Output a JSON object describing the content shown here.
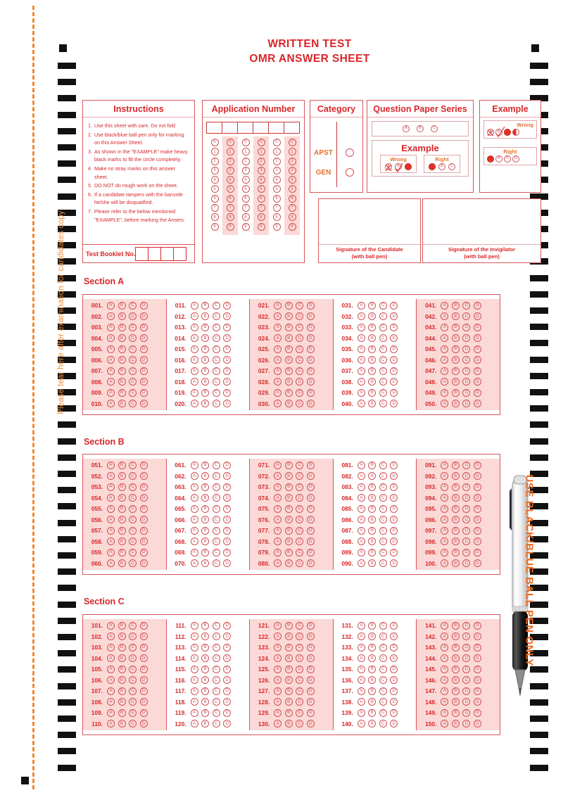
{
  "page": {
    "title_lines": [
      "WRITTEN TEST",
      "OMR ANSWER SHEET"
    ],
    "tear_text": "Please tear here after examination for candidates copy",
    "accent_red": "#d8262a",
    "bubble_red": "#cf5257",
    "shade_pink": "#fbd9d6",
    "orange": "#ef8a33"
  },
  "instructions": {
    "title": "Instructions",
    "items": [
      "Use this sheet with care. Do not fold",
      "Use black/blue ball pen only for marking on this Answer Sheet.",
      "As shown in the \"EXAMPLE\" make heavy black marks to fill the circle completely.",
      "Make no stray marks on this answer sheet.",
      "DO NOT do rough work on the sheet.",
      "If a candidate tampers with the barcode he/she will be disqualified.",
      "Please refer to the below mentioned \"EXAMPLE\", before marking the Ansers."
    ],
    "booklet_label": "Test Booklet No.",
    "booklet_cells": 4
  },
  "application_number": {
    "title": "Application Number",
    "columns": 6,
    "digits": [
      "0",
      "1",
      "2",
      "3",
      "4",
      "5",
      "6",
      "7",
      "8",
      "9"
    ],
    "shaded_columns": [
      1,
      3,
      5
    ]
  },
  "category": {
    "title": "Category",
    "options": [
      "APST",
      "GEN"
    ]
  },
  "question_paper_series": {
    "title": "Question Paper Series",
    "options": [
      "A",
      "B",
      "C"
    ],
    "example_title": "Example",
    "wrong_label": "Wrong",
    "right_label": "Right",
    "wrong_bubbles": [
      "A",
      "B",
      "C"
    ],
    "right_bubbles": [
      "A",
      "B",
      "C"
    ]
  },
  "example": {
    "title": "Example",
    "wrong_label": "Wrong",
    "right_label": "Right",
    "wrong_bubbles": [
      "A",
      "B",
      "C",
      "D"
    ],
    "right_bubbles": [
      "A",
      "B",
      "C",
      "D"
    ]
  },
  "signatures": [
    {
      "line1": "Signature of the Candidate",
      "line2": "(with ball pen)"
    },
    {
      "line1": "Signature of the Invigilator",
      "line2": "(with ball pen)"
    }
  ],
  "answer_options": [
    "A",
    "B",
    "C",
    "D"
  ],
  "sections": [
    {
      "title": "Section A",
      "groups": [
        {
          "shaded": true,
          "numbers": [
            "001.",
            "002.",
            "003.",
            "004.",
            "005.",
            "006.",
            "007.",
            "008.",
            "009.",
            "010."
          ]
        },
        {
          "shaded": false,
          "numbers": [
            "011.",
            "012.",
            "013.",
            "014.",
            "015.",
            "016.",
            "017.",
            "018.",
            "019.",
            "020."
          ]
        },
        {
          "shaded": true,
          "numbers": [
            "021.",
            "022.",
            "023.",
            "024.",
            "025.",
            "026.",
            "027.",
            "028.",
            "029.",
            "030."
          ]
        },
        {
          "shaded": false,
          "numbers": [
            "031.",
            "032.",
            "033.",
            "034.",
            "035.",
            "036.",
            "037.",
            "038.",
            "039.",
            "040."
          ]
        },
        {
          "shaded": true,
          "numbers": [
            "041.",
            "042.",
            "043.",
            "044.",
            "045.",
            "046.",
            "047.",
            "048.",
            "049.",
            "050."
          ]
        }
      ]
    },
    {
      "title": "Section B",
      "groups": [
        {
          "shaded": true,
          "numbers": [
            "051.",
            "052.",
            "053.",
            "054.",
            "055.",
            "056.",
            "057.",
            "058.",
            "059.",
            "060."
          ]
        },
        {
          "shaded": false,
          "numbers": [
            "061.",
            "062.",
            "063.",
            "064.",
            "065.",
            "066.",
            "067.",
            "068.",
            "069.",
            "070."
          ]
        },
        {
          "shaded": true,
          "numbers": [
            "071.",
            "072.",
            "073.",
            "074.",
            "075.",
            "076.",
            "077.",
            "078.",
            "079.",
            "080."
          ]
        },
        {
          "shaded": false,
          "numbers": [
            "081.",
            "082.",
            "083.",
            "084.",
            "085.",
            "086.",
            "087.",
            "088.",
            "089.",
            "090."
          ]
        },
        {
          "shaded": true,
          "numbers": [
            "091.",
            "092.",
            "093.",
            "094.",
            "095.",
            "096.",
            "097.",
            "098.",
            "099.",
            "100."
          ]
        }
      ]
    },
    {
      "title": "Section C",
      "groups": [
        {
          "shaded": true,
          "numbers": [
            "101.",
            "102.",
            "103.",
            "104.",
            "105.",
            "106.",
            "107.",
            "108.",
            "109.",
            "110."
          ]
        },
        {
          "shaded": false,
          "numbers": [
            "111.",
            "112.",
            "113.",
            "114.",
            "115.",
            "116.",
            "117.",
            "118.",
            "119.",
            "120."
          ]
        },
        {
          "shaded": true,
          "numbers": [
            "121.",
            "122.",
            "123.",
            "124.",
            "125.",
            "126.",
            "127.",
            "128.",
            "129.",
            "130."
          ]
        },
        {
          "shaded": false,
          "numbers": [
            "131.",
            "132.",
            "133.",
            "134.",
            "135.",
            "136.",
            "137.",
            "138.",
            "139.",
            "140."
          ]
        },
        {
          "shaded": true,
          "numbers": [
            "141.",
            "142.",
            "143.",
            "144.",
            "145.",
            "146.",
            "147.",
            "148.",
            "149.",
            "150."
          ]
        }
      ]
    }
  ],
  "pen": {
    "text": "USE BLACK/BLUE BALL PEN ONLY"
  }
}
